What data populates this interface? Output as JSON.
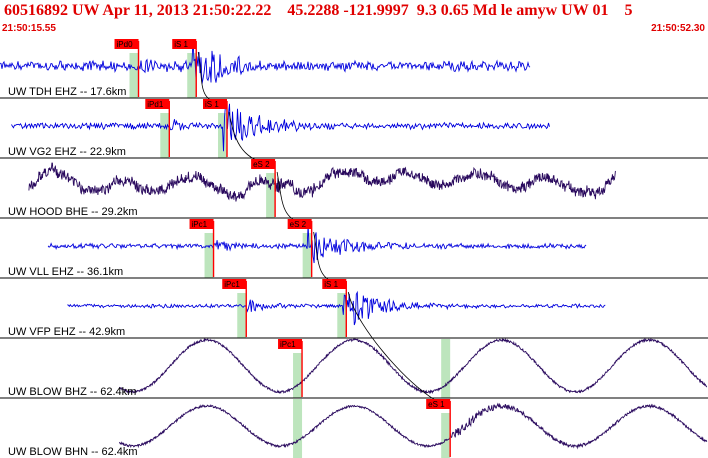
{
  "header": {
    "title": "60516892 UW Apr 11, 2013 21:50:22.22    45.2288 -121.9997  9.3 0.65 Md le amyw UW 01    5",
    "start_time": "21:50:15.55",
    "end_time": "21:50:52.30"
  },
  "colors": {
    "short_period_trace": "#0000dd",
    "broadband_trace": "#2a0a5e",
    "pick": "#ff0000",
    "pick_window": "#bde5bd",
    "moveout_curve": "#000000",
    "divider": "#000000"
  },
  "time_window": {
    "start": 0,
    "end": 36.75
  },
  "panels": [
    {
      "label": "UW TDH EHZ -- 17.6km",
      "color_key": "short_period_trace",
      "kind": "hf",
      "on": 0,
      "off": 27.6,
      "noise": 8,
      "p": 7.2,
      "s": 10.2,
      "amp": 30,
      "seed": 11,
      "picks": [
        {
          "label": "iPd0",
          "t": 7.2,
          "windowed": true
        },
        {
          "label": "iS 1",
          "t": 10.2,
          "windowed": true
        }
      ]
    },
    {
      "label": "UW VG2 EHZ -- 22.9km",
      "color_key": "short_period_trace",
      "kind": "hf",
      "on": 0.6,
      "off": 28.6,
      "noise": 5,
      "p": 8.8,
      "s": 11.8,
      "amp": 32,
      "seed": 23,
      "picks": [
        {
          "label": "iPd1",
          "t": 8.8,
          "windowed": true
        },
        {
          "label": "iS 1",
          "t": 11.8,
          "windowed": true
        }
      ]
    },
    {
      "label": "UW HOOD BHE -- 29.2km",
      "color_key": "broadband_trace",
      "kind": "mixed",
      "on": 1.5,
      "off": 32,
      "noise": 11,
      "p": null,
      "s": 14.3,
      "amp": 12,
      "seed": 37,
      "picks": [
        {
          "label": "eS 2",
          "t": 14.3,
          "windowed": true
        }
      ]
    },
    {
      "label": "UW VLL EHZ -- 36.1km",
      "color_key": "short_period_trace",
      "kind": "hf",
      "on": 2.5,
      "off": 30.5,
      "noise": 4,
      "p": 11.1,
      "s": 16.2,
      "amp": 24,
      "seed": 41,
      "picks": [
        {
          "label": "iPc1",
          "t": 11.1,
          "windowed": true
        },
        {
          "label": "eS 2",
          "t": 16.2,
          "windowed": true
        }
      ]
    },
    {
      "label": "UW VFP EHZ -- 42.9km",
      "color_key": "short_period_trace",
      "kind": "hf",
      "on": 3.5,
      "off": 31.5,
      "noise": 3,
      "p": 12.8,
      "s": 18.0,
      "amp": 30,
      "seed": 53,
      "picks": [
        {
          "label": "iPc1",
          "t": 12.8,
          "windowed": true
        },
        {
          "label": "iS 1",
          "t": 18.0,
          "windowed": true
        }
      ]
    },
    {
      "label": "UW BLOW BHZ -- 62.4km",
      "color_key": "broadband_trace",
      "kind": "lp",
      "on": 6.2,
      "off": 36.75,
      "noise": 26,
      "p": 15.7,
      "s": null,
      "amp": 0,
      "seed": 67,
      "picks": [
        {
          "label": "iPc1",
          "t": 15.7,
          "windowed": true
        }
      ]
    },
    {
      "label": "UW BLOW BHN -- 62.4km",
      "color_key": "broadband_trace",
      "kind": "lpS",
      "on": 6.2,
      "off": 36.75,
      "noise": 20,
      "p": null,
      "s": 23.4,
      "amp": 10,
      "seed": 79,
      "picks": [
        {
          "label": "eS 1",
          "t": 23.4,
          "windowed": true
        }
      ]
    }
  ],
  "extra_windows": [
    {
      "panel": 5,
      "t": 23.4
    },
    {
      "panel": 6,
      "t": 15.7
    }
  ]
}
